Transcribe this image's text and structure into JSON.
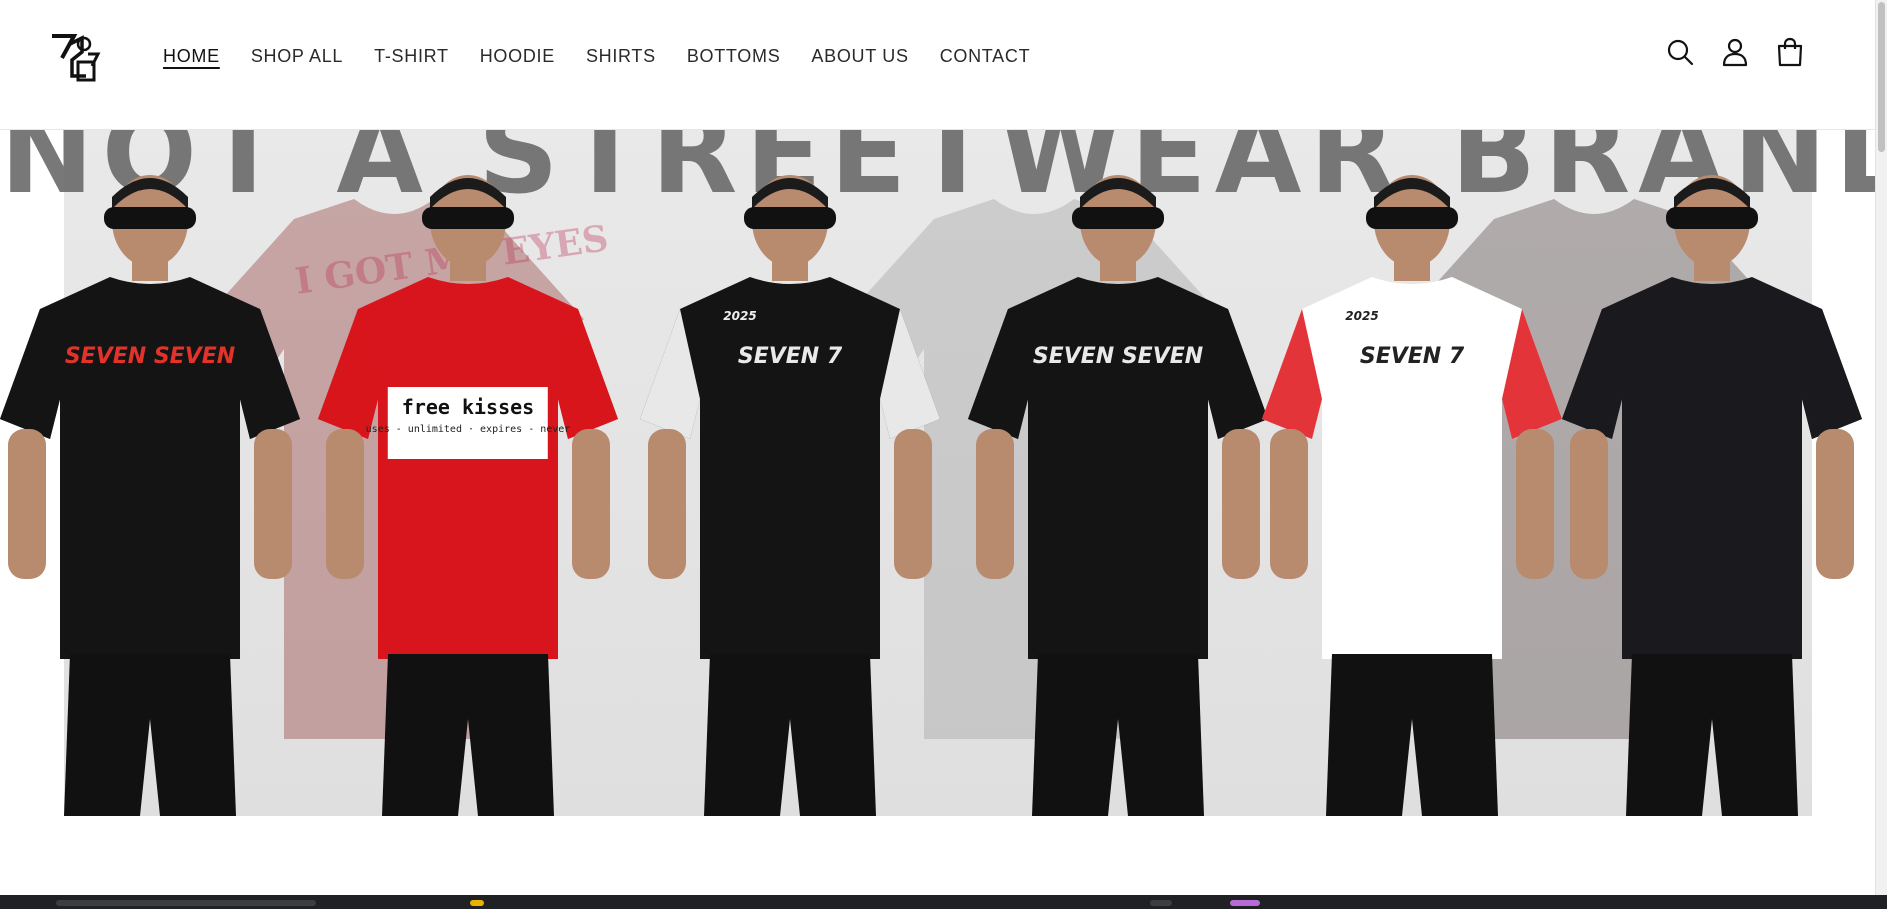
{
  "nav": {
    "items": [
      {
        "label": "HOME",
        "active": true
      },
      {
        "label": "SHOP ALL"
      },
      {
        "label": "T-SHIRT"
      },
      {
        "label": "HOODIE"
      },
      {
        "label": "SHIRTS"
      },
      {
        "label": "BOTTOMS"
      },
      {
        "label": "ABOUT US"
      },
      {
        "label": "CONTACT"
      }
    ]
  },
  "header_icons": [
    "search-icon",
    "account-icon",
    "cart-icon"
  ],
  "hero": {
    "slogan": "NOT A STREETWEAR BRAND",
    "backdrop_text": "I GOT MY EYES",
    "models": [
      {
        "shirt_color": "#141414",
        "print": "SEVEN SEVEN"
      },
      {
        "shirt_color": "#d8151c",
        "print": "free kisses",
        "print_sub": "uses - unlimited · expires - never"
      },
      {
        "shirt_color": "#141414",
        "print": "SEVEN 7",
        "print_tag": "2025"
      },
      {
        "shirt_color": "#141414",
        "print": "SEVEN SEVEN"
      },
      {
        "shirt_color": "#ffffff",
        "print": "SEVEN 7",
        "print_tag": "2025"
      },
      {
        "shirt_color": "#1a1a1e",
        "print": ""
      }
    ]
  },
  "colors": {
    "accent": "#d8151c",
    "dark": "#141414",
    "slogan": "#6a6a6a"
  }
}
